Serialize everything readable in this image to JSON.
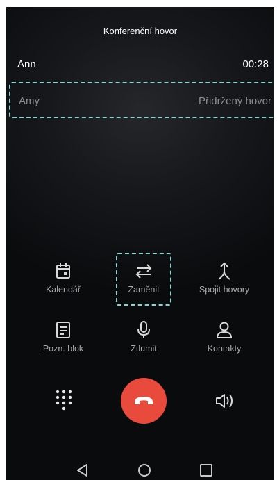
{
  "header": {
    "title": "Konferenční hovor"
  },
  "active_call": {
    "name": "Ann",
    "timer": "00:28"
  },
  "held_call": {
    "name": "Amy",
    "status": "Přidržený hovor"
  },
  "actions": [
    {
      "label": "Kalendář",
      "icon": "calendar-icon"
    },
    {
      "label": "Zaměnit",
      "icon": "swap-icon"
    },
    {
      "label": "Spojit hovory",
      "icon": "merge-calls-icon"
    },
    {
      "label": "Pozn. blok",
      "icon": "notepad-icon"
    },
    {
      "label": "Ztlumit",
      "icon": "microphone-icon"
    },
    {
      "label": "Kontakty",
      "icon": "contacts-icon"
    }
  ],
  "bottom_controls": {
    "dialpad_icon": "dialpad-icon",
    "end_call_icon": "end-call-icon",
    "speaker_icon": "speaker-icon",
    "end_call_color": "#e84b3c"
  },
  "navigation": {
    "back_icon": "back-icon",
    "home_icon": "home-icon",
    "recents_icon": "recents-icon"
  },
  "colors": {
    "highlight": "#8fd1cf",
    "end_call": "#e84b3c"
  }
}
